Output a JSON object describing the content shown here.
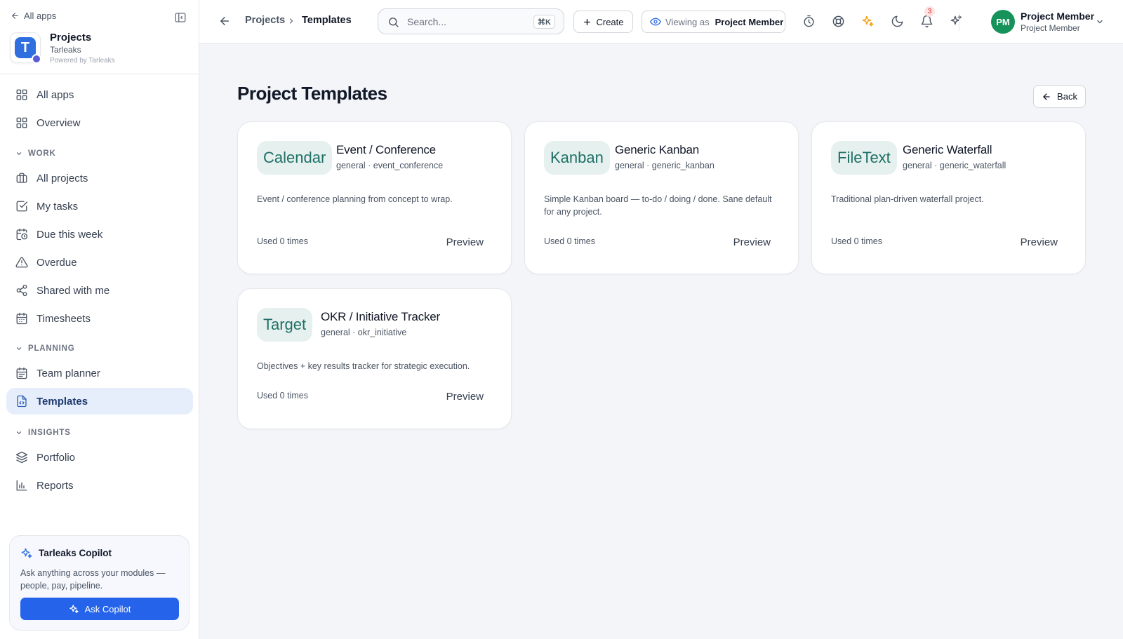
{
  "sidebar": {
    "back_label": "All apps",
    "app": {
      "name": "Projects",
      "org": "Tarleaks",
      "powered": "Powered by Tarleaks",
      "logo_letter": "T"
    },
    "top_items": [
      {
        "label": "All apps",
        "icon": "grid-icon"
      },
      {
        "label": "Overview",
        "icon": "grid-icon"
      }
    ],
    "sections": [
      {
        "title": "WORK",
        "items": [
          {
            "label": "All projects",
            "icon": "briefcase-icon"
          },
          {
            "label": "My tasks",
            "icon": "checkbox-icon"
          },
          {
            "label": "Due this week",
            "icon": "calendar-clock-icon"
          },
          {
            "label": "Overdue",
            "icon": "warning-icon"
          },
          {
            "label": "Shared with me",
            "icon": "share-icon"
          },
          {
            "label": "Timesheets",
            "icon": "calendar-icon"
          }
        ]
      },
      {
        "title": "PLANNING",
        "items": [
          {
            "label": "Team planner",
            "icon": "calendar-grid-icon"
          },
          {
            "label": "Templates",
            "icon": "file-template-icon",
            "active": true
          }
        ]
      },
      {
        "title": "INSIGHTS",
        "items": [
          {
            "label": "Portfolio",
            "icon": "layers-icon"
          },
          {
            "label": "Reports",
            "icon": "bar-chart-icon"
          }
        ]
      }
    ],
    "copilot": {
      "title": "Tarleaks Copilot",
      "description": "Ask anything across your modules — people, pay, pipeline.",
      "button": "Ask Copilot"
    }
  },
  "topbar": {
    "breadcrumb": [
      "Projects",
      "Templates"
    ],
    "search": {
      "placeholder": "Search...",
      "shortcut": "⌘K"
    },
    "create_label": "Create",
    "viewing_prefix": "Viewing as",
    "viewing_role": "Project Member",
    "notifications_count": "3",
    "user": {
      "initials": "PM",
      "name": "Project Member",
      "role": "Project Member"
    }
  },
  "main": {
    "title": "Project Templates",
    "back_label": "Back",
    "cards": [
      {
        "icon": "Calendar",
        "title": "Event / Conference",
        "subtitle": "general · event_conference",
        "description": "Event / conference planning from concept to wrap.",
        "used": "Used 0 times",
        "action": "Preview"
      },
      {
        "icon": "Kanban",
        "title": "Generic Kanban",
        "subtitle": "general · generic_kanban",
        "description": "Simple Kanban board — to-do / doing / done. Sane default for any project.",
        "used": "Used 0 times",
        "action": "Preview"
      },
      {
        "icon": "FileText",
        "title": "Generic Waterfall",
        "subtitle": "general · generic_waterfall",
        "description": "Traditional plan-driven waterfall project.",
        "used": "Used 0 times",
        "action": "Preview"
      },
      {
        "icon": "Target",
        "title": "OKR / Initiative Tracker",
        "subtitle": "general · okr_initiative",
        "description": "Objectives + key results tracker for strategic execution.",
        "used": "Used 0 times",
        "action": "Preview"
      }
    ]
  },
  "colors": {
    "accent": "#2563eb",
    "active_nav_bg": "#e6eefb",
    "chip_bg": "#e6f1ef",
    "chip_text": "#1f6f66",
    "avatar_bg": "#16935b",
    "sparkle": "#f59e0b"
  }
}
